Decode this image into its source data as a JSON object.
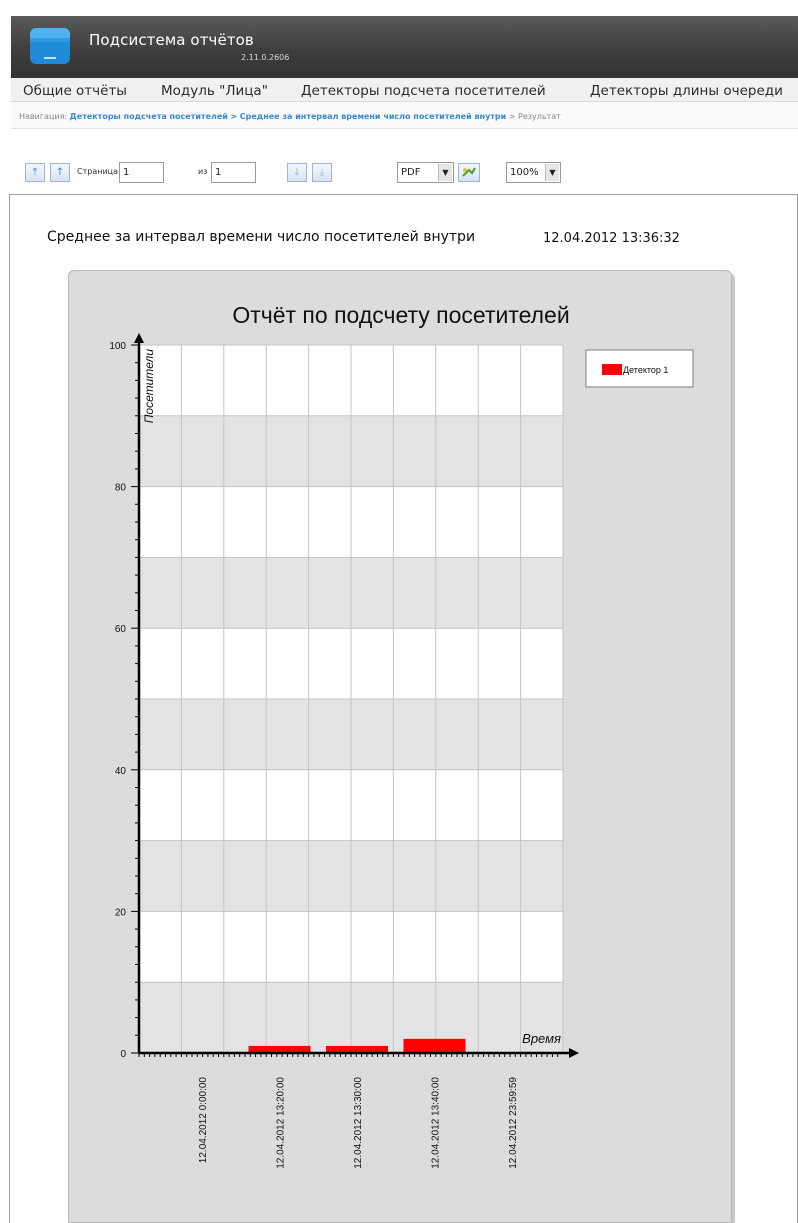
{
  "app": {
    "title": "Подсистема отчётов",
    "version": "2.11.0.2606"
  },
  "menu": {
    "items": [
      {
        "label": "Общие отчёты"
      },
      {
        "label": "Модуль \"Лица\""
      },
      {
        "label": "Детекторы подсчета посетителей"
      },
      {
        "label": "Детекторы длины очереди"
      }
    ]
  },
  "breadcrumb": {
    "prefix": "Навигация:",
    "link1": "Детекторы подсчета посетителей",
    "sep1": ">",
    "link2": "Среднее за интервал времени число посетителей внутри",
    "sep2": ">",
    "current": "Результат"
  },
  "toolbar": {
    "first_icon": "first-page-icon",
    "prev_icon": "prev-page-icon",
    "page_label": "Страница",
    "page_value": "1",
    "of_label": "из",
    "total_value": "1",
    "next_icon": "next-page-icon",
    "last_icon": "last-page-icon",
    "format_value": "PDF",
    "export_icon": "export-icon",
    "zoom_value": "100%"
  },
  "report": {
    "title": "Среднее за интервал времени число посетителей внутри",
    "timestamp": "12.04.2012 13:36:32"
  },
  "chart_data": {
    "type": "bar",
    "title": "Отчёт по подсчету посетителей",
    "xlabel": "Время",
    "ylabel": "Посетители",
    "ylim": [
      0,
      100
    ],
    "yticks": [
      0,
      20,
      40,
      60,
      80,
      100
    ],
    "grid": true,
    "legend_position": "top-right",
    "categories": [
      "12.04.2012 0:00:00",
      "12.04.2012 13:20:00",
      "12.04.2012 13:30:00",
      "12.04.2012 13:40:00",
      "12.04.2012 23:59:59"
    ],
    "series": [
      {
        "name": "Детектор 1",
        "color": "#ff0000",
        "values": [
          0,
          1,
          1,
          2,
          0
        ]
      }
    ]
  }
}
